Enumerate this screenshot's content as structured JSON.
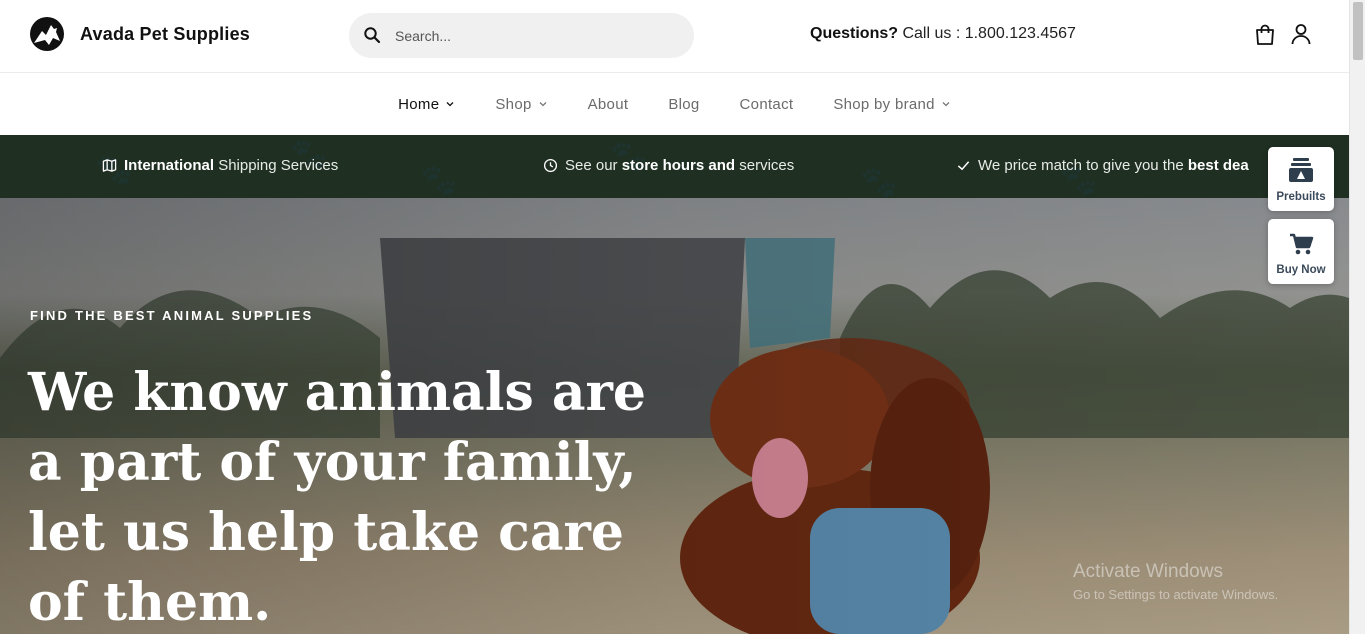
{
  "header": {
    "brand": "Avada Pet Supplies",
    "logo_icon": "dog-silhouette-logo",
    "search_placeholder": "Search...",
    "contact_prefix": "Questions?",
    "contact_rest": "Call us : 1.800.123.4567",
    "cart_icon": "cart-icon",
    "account_icon": "user-icon"
  },
  "nav": {
    "items": [
      {
        "label": "Home",
        "dropdown": true
      },
      {
        "label": "Shop",
        "dropdown": true
      },
      {
        "label": "About",
        "dropdown": false
      },
      {
        "label": "Blog",
        "dropdown": false
      },
      {
        "label": "Contact",
        "dropdown": false
      },
      {
        "label": "Shop by brand",
        "dropdown": true
      }
    ]
  },
  "promo": {
    "item1_bold": "International",
    "item1_rest": "Shipping Services",
    "item2_pre": "See our",
    "item2_bold": "store hours and",
    "item2_rest": "services",
    "item3_pre": "We price match to give you the",
    "item3_bold": "best dea"
  },
  "hero": {
    "kicker": "FIND THE BEST ANIMAL SUPPLIES",
    "headline": "We know animals are a part of your family, let us help take care of them."
  },
  "widgets": {
    "prebuilts": "Prebuilts",
    "buy_now": "Buy Now"
  },
  "watermark": {
    "line1": "Activate Windows",
    "line2": "Go to Settings to activate Windows."
  },
  "colors": {
    "promo_bg": "#1f2f22",
    "nav_active": "#111111",
    "nav_inactive": "#6b6b6b"
  }
}
